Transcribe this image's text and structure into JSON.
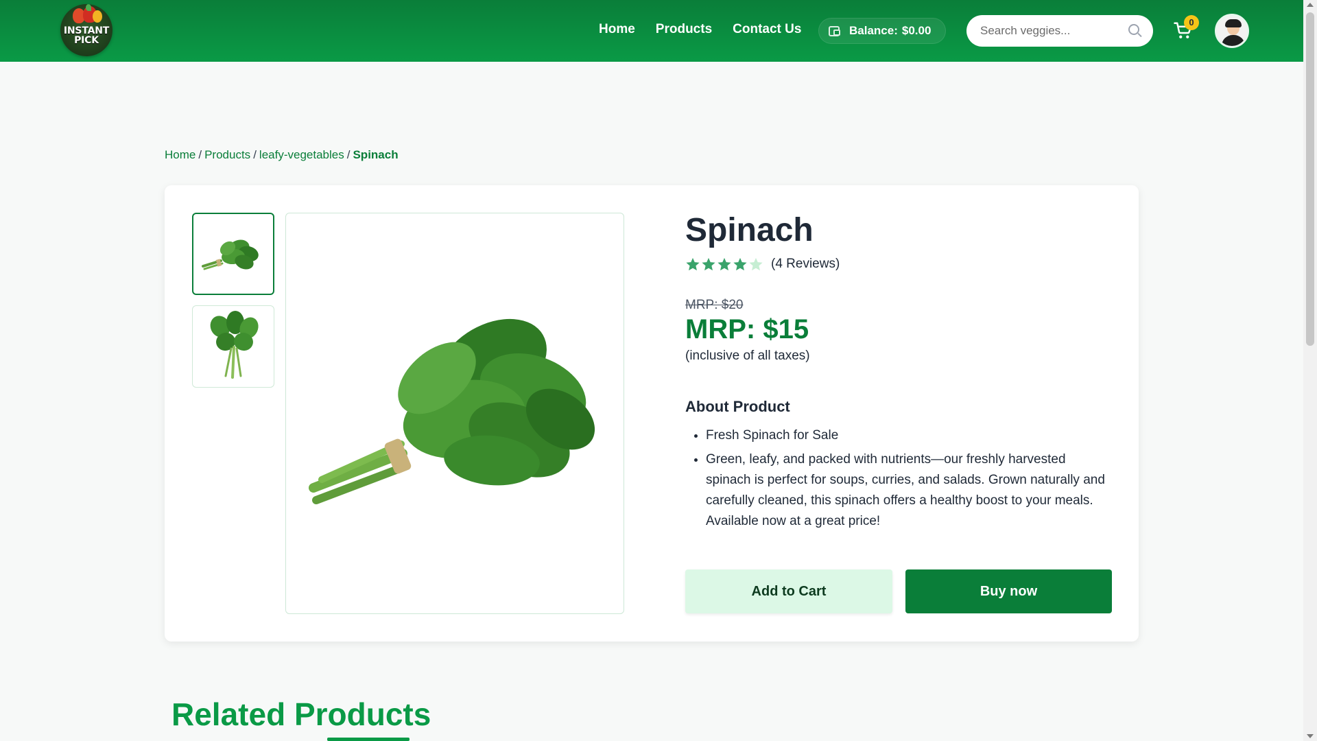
{
  "header": {
    "logo_text": "INSTANT PICK",
    "nav": [
      "Home",
      "Products",
      "Contact Us"
    ],
    "balance_label": "Balance:",
    "balance_amount": "$0.00",
    "search_placeholder": "Search veggies...",
    "cart_count": "0"
  },
  "breadcrumb": {
    "items": [
      "Home",
      "Products",
      "leafy-vegetables"
    ],
    "current": "Spinach"
  },
  "product": {
    "name": "Spinach",
    "rating": 4,
    "rating_max": 5,
    "reviews_text": "(4 Reviews)",
    "old_price": "MRP: $20",
    "price": "MRP: $15",
    "tax_note": "(inclusive of all taxes)",
    "about_title": "About Product",
    "about_points": [
      "Fresh Spinach for Sale",
      "Green, leafy, and packed with nutrients—our freshly harvested spinach is perfect for soups, curries, and salads. Grown naturally and carefully cleaned, this spinach offers a healthy boost to your meals. Available now at a great price!"
    ],
    "add_to_cart_label": "Add to Cart",
    "buy_now_label": "Buy now"
  },
  "related": {
    "title": "Related Products"
  },
  "colors": {
    "brand_green": "#0a7e39",
    "accent_green": "#0a9a46",
    "star_green": "#3aa36b",
    "star_empty": "#c6eed3",
    "badge_yellow": "#f5c518"
  },
  "icons": [
    "wallet-icon",
    "search-icon",
    "cart-icon",
    "avatar-icon",
    "star-icon"
  ]
}
